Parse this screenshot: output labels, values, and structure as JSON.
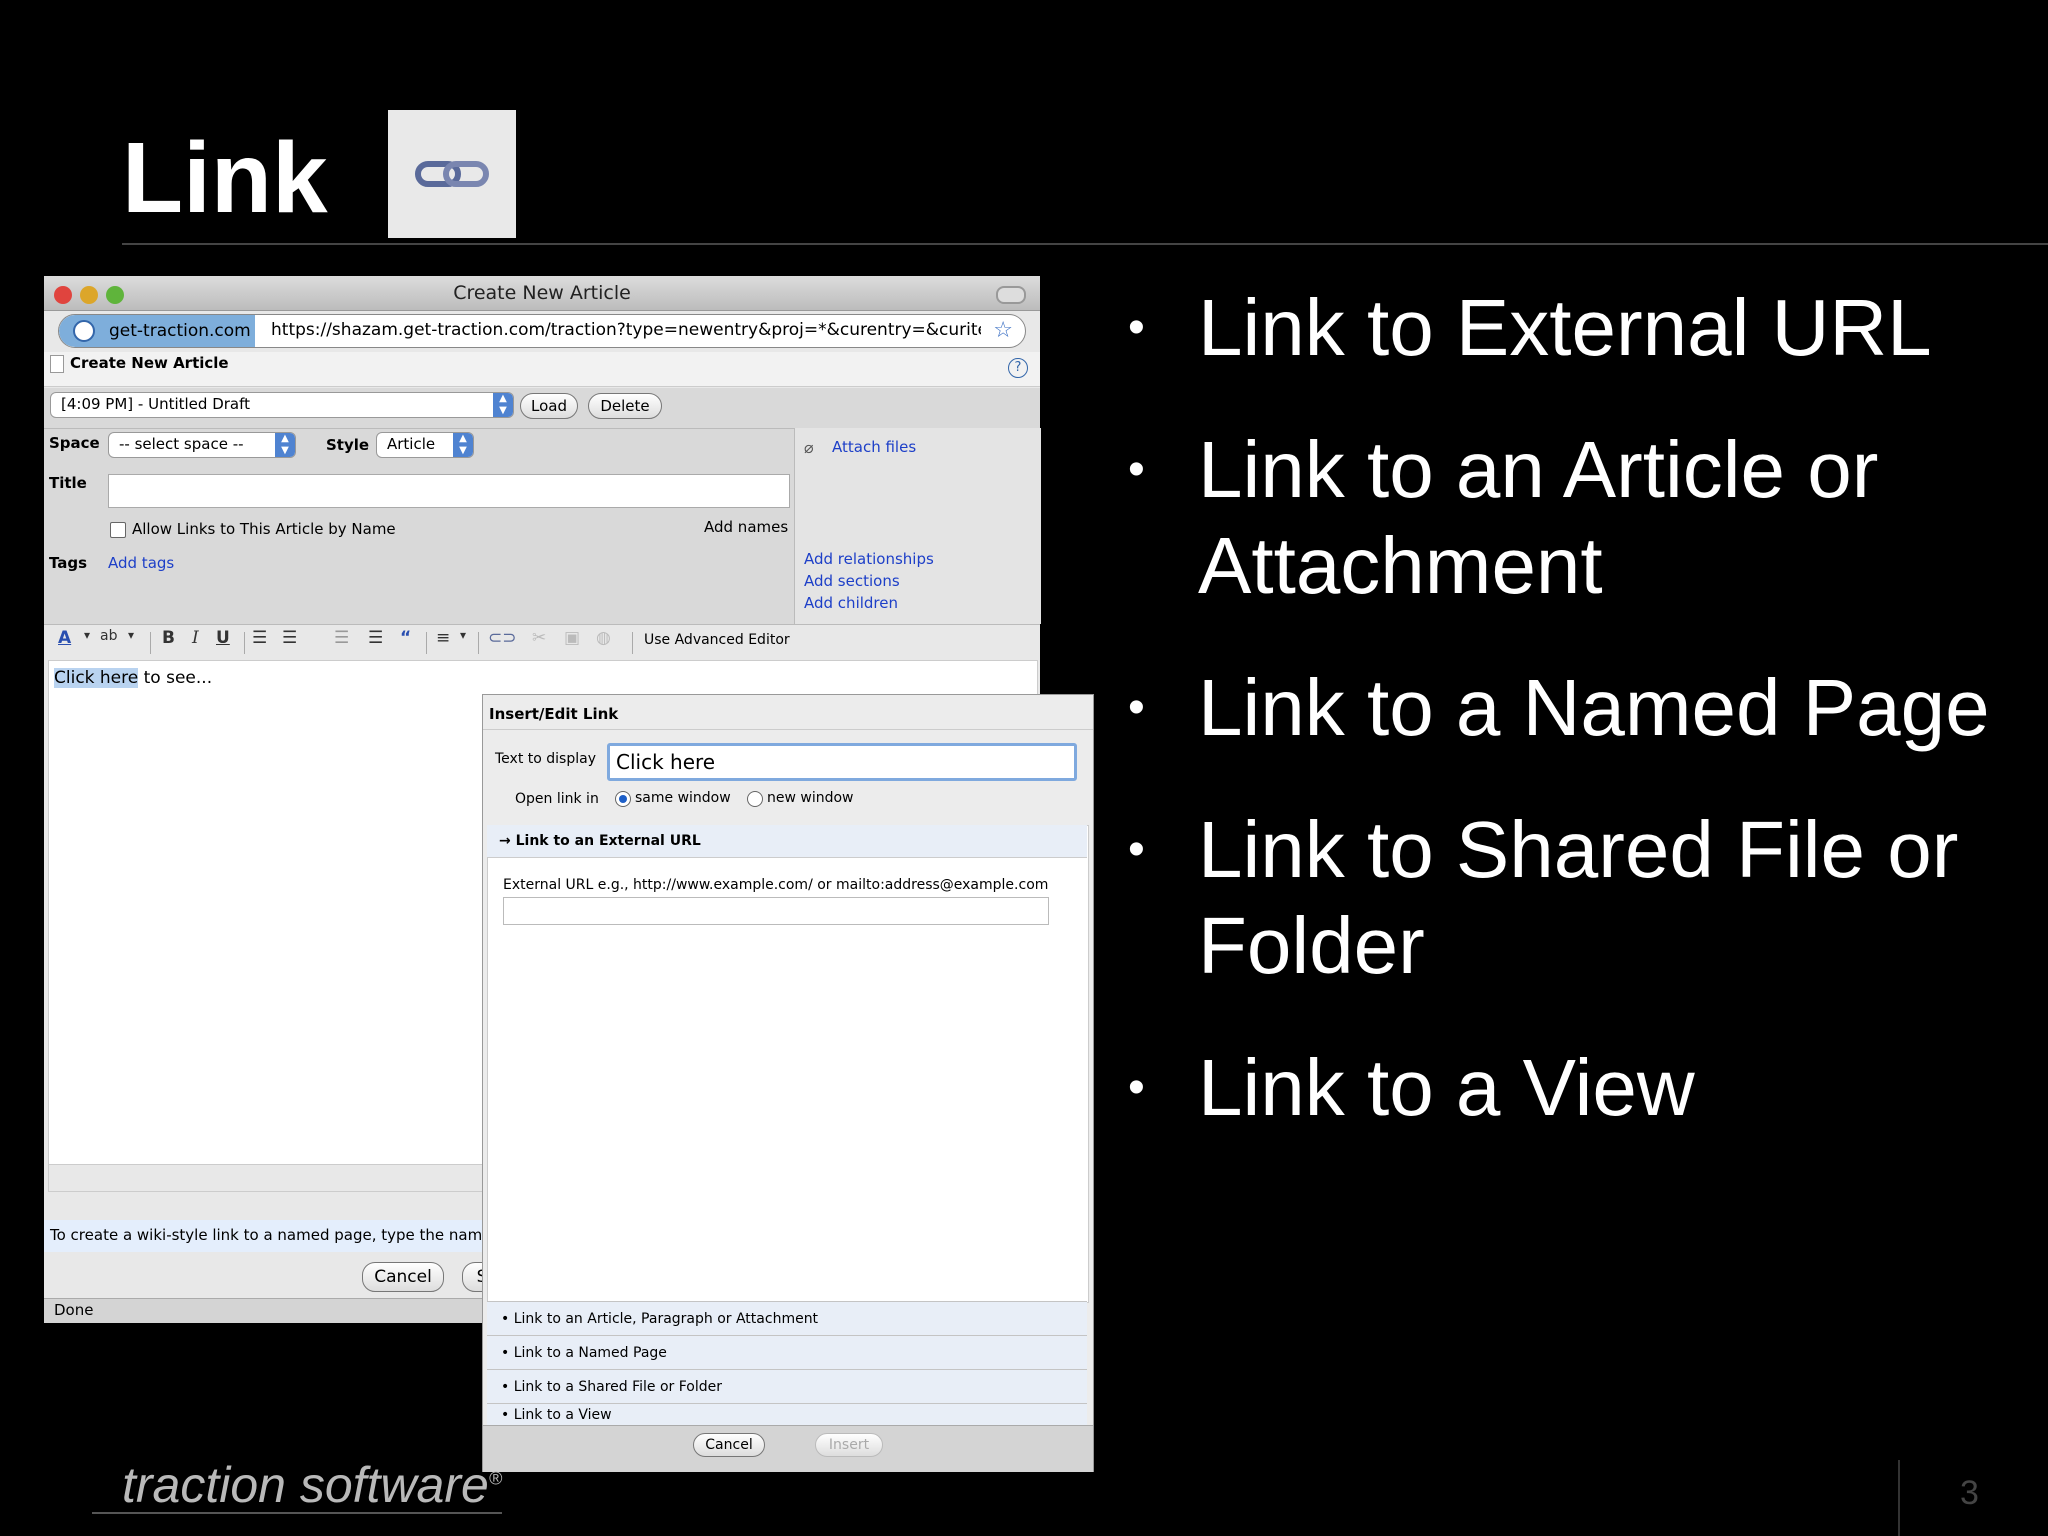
{
  "slide": {
    "title": "Link",
    "bullets": [
      "Link to External URL",
      "Link to an Article or Attachment",
      "Link to a Named Page",
      "Link to Shared File or Folder",
      "Link to a View"
    ],
    "footer_logo": "traction software",
    "page_number": "3"
  },
  "browser": {
    "window_title": "Create New Article",
    "site_badge": "get-traction.com",
    "url": "https://shazam.get-traction.com/traction?type=newentry&proj=*&curentry=&curiter",
    "page_title": "Create New Article",
    "draft_select": "[4:09 PM] - Untitled Draft",
    "load_label": "Load",
    "delete_label": "Delete",
    "space_label": "Space",
    "space_select": "-- select space --",
    "style_label": "Style",
    "style_select": "Article",
    "title_label": "Title",
    "title_value": "",
    "allow_links_label": "Allow Links to This Article by Name",
    "add_names": "Add names",
    "tags_label": "Tags",
    "add_tags": "Add tags",
    "attach_files": "Attach files",
    "add_relationships": "Add relationships",
    "add_sections": "Add sections",
    "add_children": "Add children",
    "use_advanced_editor": "Use Advanced Editor",
    "editor_link_text": "Click here",
    "editor_rest_text": " to see...",
    "help_text": "To create a wiki-style link to a named page, type the name",
    "cancel_label": "Cancel",
    "save_label_partial": "S",
    "status": "Done"
  },
  "dialog": {
    "title": "Insert/Edit Link",
    "text_to_display_label": "Text to display",
    "text_to_display_value": "Click here",
    "open_link_in_label": "Open link in",
    "same_window_label": "same window",
    "new_window_label": "new window",
    "open_link_selected": "same window",
    "section_title": "→ Link to an External URL",
    "external_url_label": "External URL e.g., http://www.example.com/ or mailto:address@example.com",
    "external_url_value": "",
    "options": [
      "• Link to an Article, Paragraph or Attachment",
      "• Link to a Named Page",
      "• Link to a Shared File or Folder",
      "• Link to a View"
    ],
    "cancel_label": "Cancel",
    "insert_label": "Insert"
  }
}
